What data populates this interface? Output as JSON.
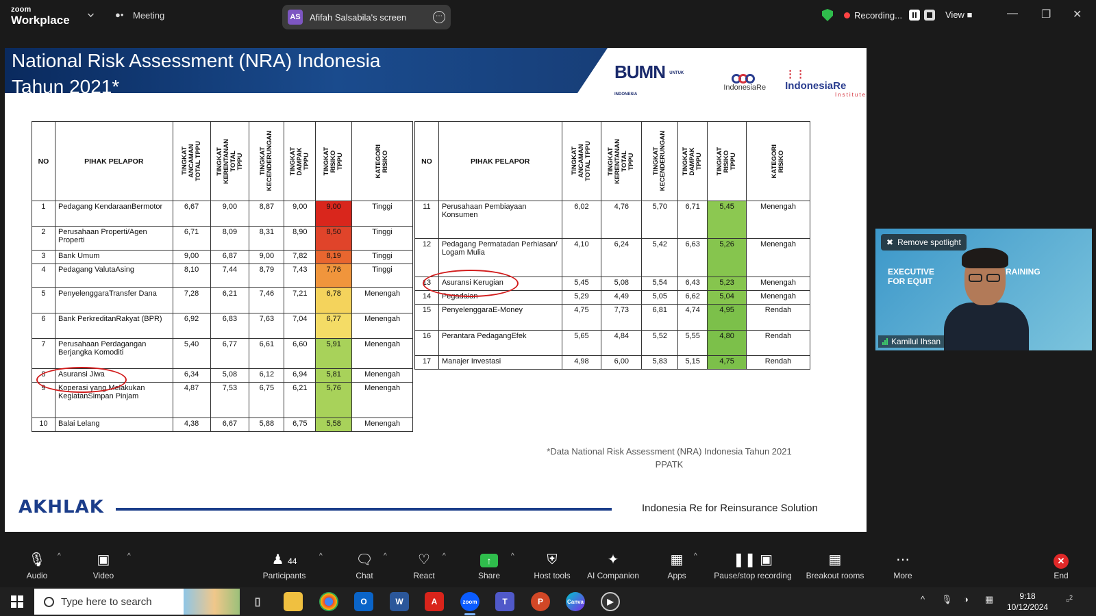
{
  "topbar": {
    "brand_small": "zoom",
    "brand_large": "Workplace",
    "meeting_label": "Meeting",
    "share_initials": "AS",
    "share_title": "Afifah Salsabila's screen",
    "recording_label": "Recording...",
    "view_label": "View"
  },
  "slide": {
    "title_line1": "National Risk Assessment (NRA) Indonesia",
    "title_line2": "Tahun 2021*",
    "logo_bumn": "BUMN",
    "logo_bumn_sub": "UNTUK INDONESIA",
    "logo_indonesiare": "IndonesiaRe",
    "logo_iri": "IndonesiaRe",
    "logo_iri_sub": "Institute",
    "headers": {
      "no": "NO",
      "pihak": "PIHAK PELAPOR",
      "ancaman": "TINGKAT\nANCAMAN\nTOTAL TPPU",
      "kerentanan": "TINGKAT\nKERENTANAN\nTOTAL\nTPPU",
      "kecenderungan": "TINGKAT\nKECENDERUNGAN",
      "dampak": "TINGKAT\nDAMPAK\nTPPU",
      "risiko": "TINGKAT\nRISIKO\nTPPU",
      "kategori": "KATEGORI\nRISIKO"
    },
    "left_rows": [
      {
        "no": "1",
        "pihak": "Pedagang KendaraanBermotor",
        "a": "6,67",
        "k": "9,00",
        "c": "8,87",
        "d": "9,00",
        "r": "9,00",
        "kat": "Tinggi",
        "color": "#d9261c"
      },
      {
        "no": "2",
        "pihak": "Perusahaan Properti/Agen Properti",
        "a": "6,71",
        "k": "8,09",
        "c": "8,31",
        "d": "8,90",
        "r": "8,50",
        "kat": "Tinggi",
        "color": "#e0442a"
      },
      {
        "no": "3",
        "pihak": "Bank Umum",
        "a": "9,00",
        "k": "6,87",
        "c": "9,00",
        "d": "7,82",
        "r": "8,19",
        "kat": "Tinggi",
        "color": "#e8662f"
      },
      {
        "no": "4",
        "pihak": "Pedagang ValutaAsing",
        "a": "8,10",
        "k": "7,44",
        "c": "8,79",
        "d": "7,43",
        "r": "7,76",
        "kat": "Tinggi",
        "color": "#f0953c"
      },
      {
        "no": "5",
        "pihak": "PenyelenggaraTransfer Dana",
        "a": "7,28",
        "k": "6,21",
        "c": "7,46",
        "d": "7,21",
        "r": "6,78",
        "kat": "Menengah",
        "color": "#f4d35c"
      },
      {
        "no": "6",
        "pihak": "Bank PerkreditanRakyat (BPR)",
        "a": "6,92",
        "k": "6,83",
        "c": "7,63",
        "d": "7,04",
        "r": "6,77",
        "kat": "Menengah",
        "color": "#f4dc66"
      },
      {
        "no": "7",
        "pihak": "Perusahaan Perdagangan Berjangka Komoditi",
        "a": "5,40",
        "k": "6,77",
        "c": "6,61",
        "d": "6,60",
        "r": "5,91",
        "kat": "Menengah",
        "color": "#a8d25a"
      },
      {
        "no": "8",
        "pihak": "Asuransi Jiwa",
        "a": "6,34",
        "k": "5,08",
        "c": "6,12",
        "d": "6,94",
        "r": "5,81",
        "kat": "Menengah",
        "color": "#a8d25a"
      },
      {
        "no": "9",
        "pihak": "Koperasi yang Melakukan KegiatanSimpan Pinjam",
        "a": "4,87",
        "k": "7,53",
        "c": "6,75",
        "d": "6,21",
        "r": "5,76",
        "kat": "Menengah",
        "color": "#a8d25a"
      },
      {
        "no": "10",
        "pihak": "Balai Lelang",
        "a": "4,38",
        "k": "6,67",
        "c": "5,88",
        "d": "6,75",
        "r": "5,58",
        "kat": "Menengah",
        "color": "#a8d25a"
      }
    ],
    "right_rows": [
      {
        "no": "11",
        "pihak": "Perusahaan Pembiayaan Konsumen",
        "a": "6,02",
        "k": "4,76",
        "c": "5,70",
        "d": "6,71",
        "r": "5,45",
        "kat": "Menengah",
        "color": "#8cc851"
      },
      {
        "no": "12",
        "pihak": "Pedagang Permatadan Perhiasan/ Logam Mulia",
        "a": "4,10",
        "k": "6,24",
        "c": "5,42",
        "d": "6,63",
        "r": "5,26",
        "kat": "Menengah",
        "color": "#86c54e"
      },
      {
        "no": "13",
        "pihak": "Asuransi Kerugian",
        "a": "5,45",
        "k": "5,08",
        "c": "5,54",
        "d": "6,43",
        "r": "5,23",
        "kat": "Menengah",
        "color": "#86c54e"
      },
      {
        "no": "14",
        "pihak": "Pegadaian",
        "a": "5,29",
        "k": "4,49",
        "c": "5,05",
        "d": "6,62",
        "r": "5,04",
        "kat": "Menengah",
        "color": "#86c54e"
      },
      {
        "no": "15",
        "pihak": "PenyelenggaraE-Money",
        "a": "4,75",
        "k": "7,73",
        "c": "6,81",
        "d": "4,74",
        "r": "4,95",
        "kat": "Rendah",
        "color": "#7cc04a"
      },
      {
        "no": "16",
        "pihak": "Perantara PedagangEfek",
        "a": "5,65",
        "k": "4,84",
        "c": "5,52",
        "d": "5,55",
        "r": "4,80",
        "kat": "Rendah",
        "color": "#7cc04a"
      },
      {
        "no": "17",
        "pihak": "Manajer Investasi",
        "a": "4,98",
        "k": "6,00",
        "c": "5,83",
        "d": "5,15",
        "r": "4,75",
        "kat": "Rendah",
        "color": "#7cc04a"
      }
    ],
    "footnote_line1": "*Data National Risk Assessment (NRA) Indonesia Tahun 2021",
    "footnote_line2": "PPATK",
    "akhlak": "AKHLAK",
    "tagline": "Indonesia Re for Reinsurance Solution"
  },
  "video": {
    "spotlight_label": "Remove spotlight",
    "name": "Kamilul Ihsan",
    "bg_text1": "EXECUTIVE",
    "bg_text2": "FOR EQUIT",
    "bg_text3": "RAINING"
  },
  "toolbar": {
    "audio": "Audio",
    "video": "Video",
    "participants": "Participants",
    "participants_count": "44",
    "chat": "Chat",
    "react": "React",
    "share": "Share",
    "host_tools": "Host tools",
    "ai_companion": "AI Companion",
    "apps": "Apps",
    "pause_recording": "Pause/stop recording",
    "breakout": "Breakout rooms",
    "more": "More",
    "end": "End"
  },
  "taskbar": {
    "search_placeholder": "Type here to search",
    "time": "9:18",
    "date": "10/12/2024",
    "notif_count": "2"
  }
}
